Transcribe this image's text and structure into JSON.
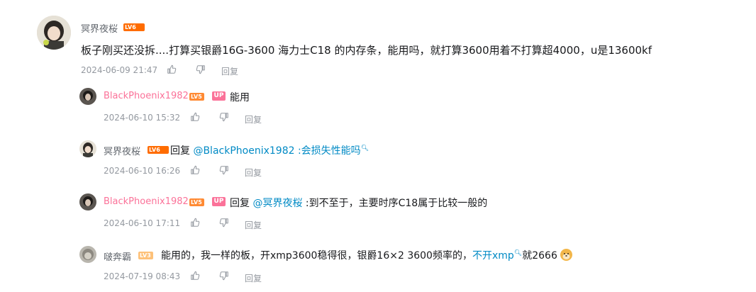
{
  "main_comment": {
    "username": "冥界夜桜",
    "level": "LV6",
    "text": "板子刚买还没拆....打算买银爵16G-3600 海力士C18 的内存条，能用吗，就打算3600用着不打算超4000，u是13600kf",
    "time": "2024-06-09 21:47",
    "reply_label": "回复"
  },
  "replies": [
    {
      "username": "BlackPhoenix1982",
      "level": "LV5",
      "badge": "UP",
      "text": "能用",
      "time": "2024-06-10 15:32",
      "reply_label": "回复"
    },
    {
      "username": "冥界夜桜",
      "level": "LV6",
      "prefix": "回复",
      "mention": "@BlackPhoenix1982",
      "text": " :会损失性能吗",
      "time": "2024-06-10 16:26",
      "reply_label": "回复"
    },
    {
      "username": "BlackPhoenix1982",
      "level": "LV5",
      "badge": "UP",
      "prefix": "回复",
      "mention": "@冥界夜桜",
      "text": " :到不至于，主要时序C18属于比较一般的",
      "time": "2024-06-10 17:11",
      "reply_label": "回复"
    },
    {
      "username": "啵奔霸",
      "level": "LV3",
      "text": "能用的，我一样的板，开xmp3600稳得很，银爵16×2 3600频率的，",
      "link": "不开xmp",
      "text_after": "就2666",
      "time": "2024-07-19 08:43",
      "reply_label": "回复"
    }
  ],
  "icons": {
    "like": "thumbs-up-icon",
    "dislike": "thumbs-down-icon",
    "search_mark": "search-icon",
    "emoji": "doge-emoji-icon"
  },
  "colors": {
    "up_name": "#fb7299",
    "link": "#008ac5",
    "meta": "#9499a0"
  }
}
